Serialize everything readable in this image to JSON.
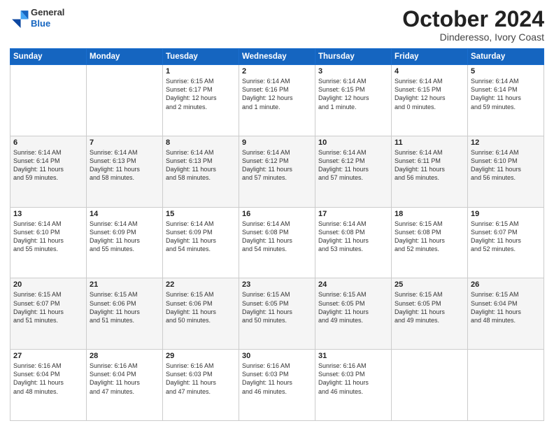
{
  "header": {
    "logo_line1": "General",
    "logo_line2": "Blue",
    "month": "October 2024",
    "location": "Dinderesso, Ivory Coast"
  },
  "days_of_week": [
    "Sunday",
    "Monday",
    "Tuesday",
    "Wednesday",
    "Thursday",
    "Friday",
    "Saturday"
  ],
  "weeks": [
    [
      {
        "day": "",
        "info": ""
      },
      {
        "day": "",
        "info": ""
      },
      {
        "day": "1",
        "info": "Sunrise: 6:15 AM\nSunset: 6:17 PM\nDaylight: 12 hours\nand 2 minutes."
      },
      {
        "day": "2",
        "info": "Sunrise: 6:14 AM\nSunset: 6:16 PM\nDaylight: 12 hours\nand 1 minute."
      },
      {
        "day": "3",
        "info": "Sunrise: 6:14 AM\nSunset: 6:15 PM\nDaylight: 12 hours\nand 1 minute."
      },
      {
        "day": "4",
        "info": "Sunrise: 6:14 AM\nSunset: 6:15 PM\nDaylight: 12 hours\nand 0 minutes."
      },
      {
        "day": "5",
        "info": "Sunrise: 6:14 AM\nSunset: 6:14 PM\nDaylight: 11 hours\nand 59 minutes."
      }
    ],
    [
      {
        "day": "6",
        "info": "Sunrise: 6:14 AM\nSunset: 6:14 PM\nDaylight: 11 hours\nand 59 minutes."
      },
      {
        "day": "7",
        "info": "Sunrise: 6:14 AM\nSunset: 6:13 PM\nDaylight: 11 hours\nand 58 minutes."
      },
      {
        "day": "8",
        "info": "Sunrise: 6:14 AM\nSunset: 6:13 PM\nDaylight: 11 hours\nand 58 minutes."
      },
      {
        "day": "9",
        "info": "Sunrise: 6:14 AM\nSunset: 6:12 PM\nDaylight: 11 hours\nand 57 minutes."
      },
      {
        "day": "10",
        "info": "Sunrise: 6:14 AM\nSunset: 6:12 PM\nDaylight: 11 hours\nand 57 minutes."
      },
      {
        "day": "11",
        "info": "Sunrise: 6:14 AM\nSunset: 6:11 PM\nDaylight: 11 hours\nand 56 minutes."
      },
      {
        "day": "12",
        "info": "Sunrise: 6:14 AM\nSunset: 6:10 PM\nDaylight: 11 hours\nand 56 minutes."
      }
    ],
    [
      {
        "day": "13",
        "info": "Sunrise: 6:14 AM\nSunset: 6:10 PM\nDaylight: 11 hours\nand 55 minutes."
      },
      {
        "day": "14",
        "info": "Sunrise: 6:14 AM\nSunset: 6:09 PM\nDaylight: 11 hours\nand 55 minutes."
      },
      {
        "day": "15",
        "info": "Sunrise: 6:14 AM\nSunset: 6:09 PM\nDaylight: 11 hours\nand 54 minutes."
      },
      {
        "day": "16",
        "info": "Sunrise: 6:14 AM\nSunset: 6:08 PM\nDaylight: 11 hours\nand 54 minutes."
      },
      {
        "day": "17",
        "info": "Sunrise: 6:14 AM\nSunset: 6:08 PM\nDaylight: 11 hours\nand 53 minutes."
      },
      {
        "day": "18",
        "info": "Sunrise: 6:15 AM\nSunset: 6:08 PM\nDaylight: 11 hours\nand 52 minutes."
      },
      {
        "day": "19",
        "info": "Sunrise: 6:15 AM\nSunset: 6:07 PM\nDaylight: 11 hours\nand 52 minutes."
      }
    ],
    [
      {
        "day": "20",
        "info": "Sunrise: 6:15 AM\nSunset: 6:07 PM\nDaylight: 11 hours\nand 51 minutes."
      },
      {
        "day": "21",
        "info": "Sunrise: 6:15 AM\nSunset: 6:06 PM\nDaylight: 11 hours\nand 51 minutes."
      },
      {
        "day": "22",
        "info": "Sunrise: 6:15 AM\nSunset: 6:06 PM\nDaylight: 11 hours\nand 50 minutes."
      },
      {
        "day": "23",
        "info": "Sunrise: 6:15 AM\nSunset: 6:05 PM\nDaylight: 11 hours\nand 50 minutes."
      },
      {
        "day": "24",
        "info": "Sunrise: 6:15 AM\nSunset: 6:05 PM\nDaylight: 11 hours\nand 49 minutes."
      },
      {
        "day": "25",
        "info": "Sunrise: 6:15 AM\nSunset: 6:05 PM\nDaylight: 11 hours\nand 49 minutes."
      },
      {
        "day": "26",
        "info": "Sunrise: 6:15 AM\nSunset: 6:04 PM\nDaylight: 11 hours\nand 48 minutes."
      }
    ],
    [
      {
        "day": "27",
        "info": "Sunrise: 6:16 AM\nSunset: 6:04 PM\nDaylight: 11 hours\nand 48 minutes."
      },
      {
        "day": "28",
        "info": "Sunrise: 6:16 AM\nSunset: 6:04 PM\nDaylight: 11 hours\nand 47 minutes."
      },
      {
        "day": "29",
        "info": "Sunrise: 6:16 AM\nSunset: 6:03 PM\nDaylight: 11 hours\nand 47 minutes."
      },
      {
        "day": "30",
        "info": "Sunrise: 6:16 AM\nSunset: 6:03 PM\nDaylight: 11 hours\nand 46 minutes."
      },
      {
        "day": "31",
        "info": "Sunrise: 6:16 AM\nSunset: 6:03 PM\nDaylight: 11 hours\nand 46 minutes."
      },
      {
        "day": "",
        "info": ""
      },
      {
        "day": "",
        "info": ""
      }
    ]
  ]
}
